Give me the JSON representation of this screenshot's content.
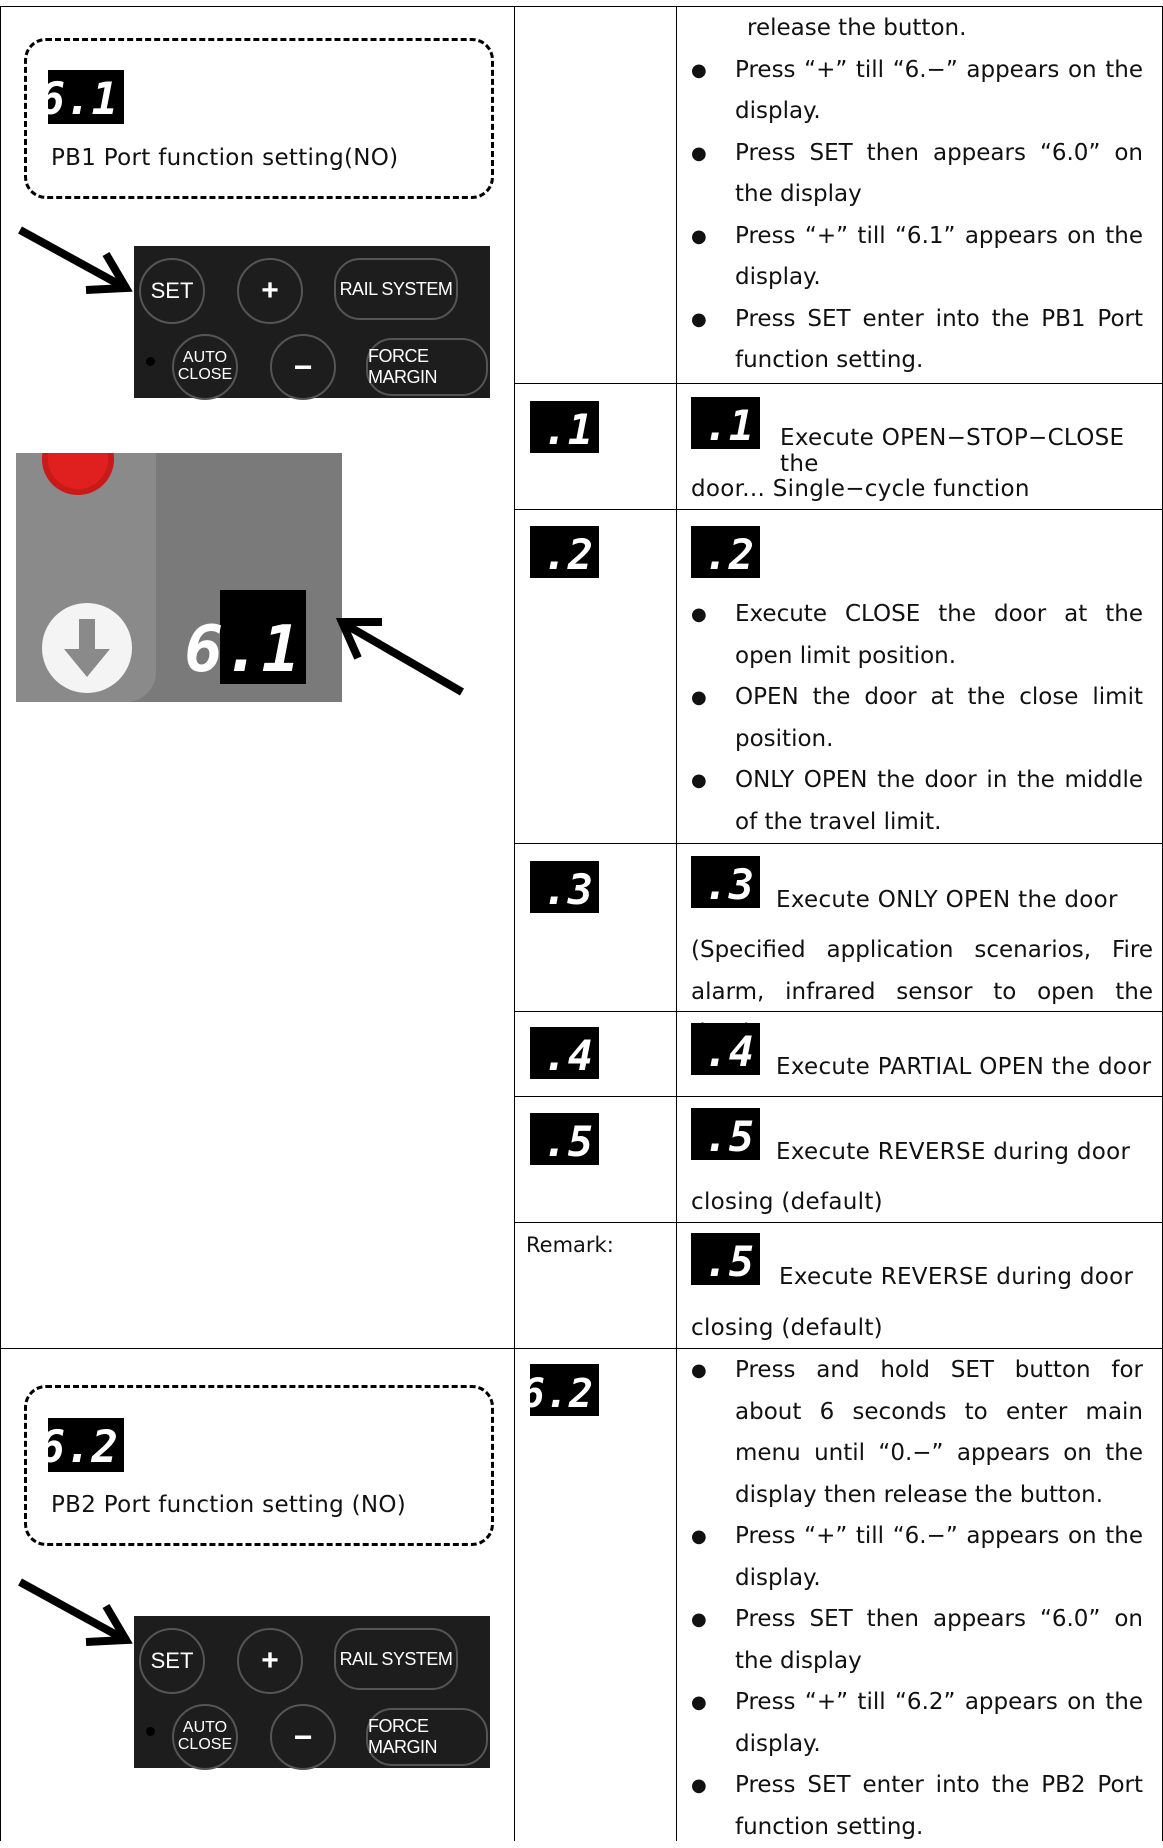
{
  "left": {
    "pb1": {
      "code": "6.1",
      "title": "PB1 Port function setting(NO)"
    },
    "pb2": {
      "code": "6.2",
      "title": "PB2 Port function setting (NO)"
    },
    "panel": {
      "set": "SET",
      "plus": "+",
      "minus": "−",
      "rail_system": "RAIL SYSTEM",
      "auto_close_1": "AUTO",
      "auto_close_2": "CLOSE",
      "force_margin": "FORCE MARGIN"
    },
    "display_photo": {
      "code": "6.1"
    }
  },
  "top_steps": [
    "release the button.",
    "Press “+” till “6.−” appears on the display.",
    "Press SET then appears “6.0” on the display",
    "Press “+” till “6.1” appears on the display.",
    "Press SET enter into the PB1 Port function setting."
  ],
  "options": {
    "o1": {
      "code": ".1",
      "text_a": "Execute OPEN−STOP−CLOSE the",
      "text_b": "door... Single−cycle function"
    },
    "o2": {
      "code": ".2",
      "bullets": [
        "Execute CLOSE the door at the open limit position.",
        "OPEN the door at the close limit position.",
        "ONLY OPEN the door in the middle of the travel limit."
      ]
    },
    "o3": {
      "code": ".3",
      "text_a": "Execute ONLY OPEN the door",
      "text_b": "(Specified application scenarios, Fire alarm, infrared sensor to open the door)"
    },
    "o4": {
      "code": ".4",
      "text_a": "Execute PARTIAL OPEN the door"
    },
    "o5": {
      "code": ".5",
      "text_a": "Execute REVERSE during door",
      "text_b": "closing (default)"
    },
    "remark": {
      "label": "Remark:",
      "code": ".5",
      "text_a": "Execute REVERSE during door",
      "text_b": "closing (default)"
    }
  },
  "pb2_steps": [
    "Press and hold SET button for about 6 seconds to enter main menu until “0.−” appears on the display then release the button.",
    "Press “+” till “6.−” appears on the display.",
    "Press SET then appears “6.0” on the display",
    "Press “+” till “6.2” appears on the display.",
    "Press SET enter into the PB2 Port function setting."
  ],
  "colors": {
    "display_bg": "#000000",
    "panel_bg": "#1d1d1d",
    "photo_bg": "#7a7a7a",
    "stop_red": "#e0201e"
  },
  "icons": [
    "arrow-icon",
    "down-arrow-icon",
    "stop-button-icon"
  ]
}
